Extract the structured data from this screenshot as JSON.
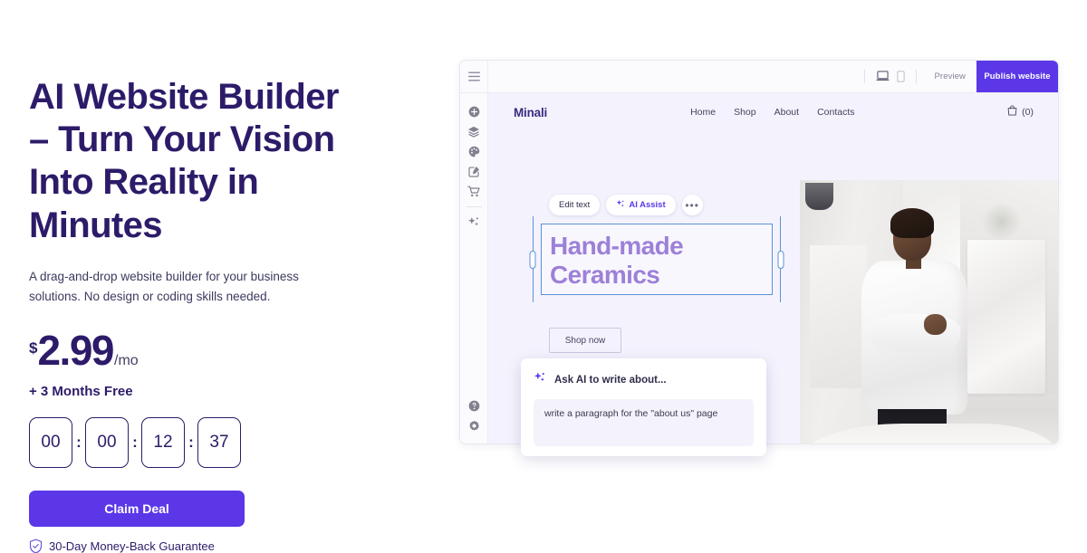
{
  "promo": {
    "headline": "AI Website Builder – Turn Your Vision Into Reality in Minutes",
    "subtitle": "A drag-and-drop website builder for your business solutions. No design or coding skills needed.",
    "price": {
      "currency": "$",
      "amount": "2.99",
      "period": "/mo"
    },
    "bonus": "+ 3 Months Free",
    "timer": {
      "values": [
        "00",
        "00",
        "12",
        "37"
      ],
      "separator": ":"
    },
    "cta_label": "Claim Deal",
    "guarantee": "30-Day Money-Back Guarantee",
    "colors": {
      "heading": "#2D1B69",
      "accent": "#5B37E8",
      "canvas": "#F4F3FD",
      "selection": "#5B90D8",
      "site_heading": "#6B3FC4"
    }
  },
  "app": {
    "toolbar": {
      "menu_icon": "hamburger-menu-icon",
      "desktop_icon": "desktop-view-icon",
      "mobile_icon": "mobile-view-icon",
      "preview_label": "Preview",
      "publish_label": "Publish website"
    },
    "rail": {
      "items": [
        {
          "icon": "plus-circle-icon",
          "name": "add-element"
        },
        {
          "icon": "layers-icon",
          "name": "layers"
        },
        {
          "icon": "palette-icon",
          "name": "theme-palette"
        },
        {
          "icon": "edit-square-icon",
          "name": "edit-page"
        },
        {
          "icon": "shopping-cart-icon",
          "name": "store"
        },
        {
          "icon": "sparkles-icon",
          "name": "ai-tools"
        }
      ],
      "bottom": [
        {
          "icon": "help-circle-icon",
          "name": "help"
        },
        {
          "icon": "gear-icon",
          "name": "settings"
        }
      ]
    },
    "site": {
      "brand": "Minali",
      "nav": [
        "Home",
        "Shop",
        "About",
        "Contacts"
      ],
      "cart_icon": "shopping-bag-icon",
      "cart_count": "(0)",
      "hero_title": "Hand-made Ceramics",
      "hero_button": "Shop now",
      "hero_image_alt": "woman-in-white-shirt-ceramics-studio"
    },
    "edit_toolbar": {
      "edit_text_label": "Edit text",
      "ai_assist_label": "AI Assist",
      "ai_icon": "sparkles-icon",
      "more_label": "•••"
    },
    "ai_popup": {
      "icon": "sparkles-icon",
      "title": "Ask AI to write about...",
      "input_value": "write a paragraph for the \"about us\" page"
    }
  }
}
